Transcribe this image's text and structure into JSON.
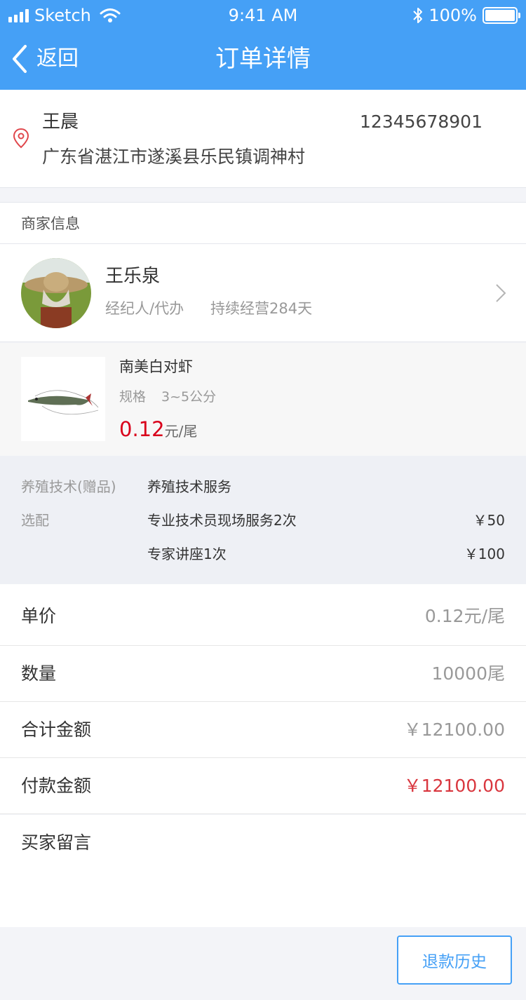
{
  "status_bar": {
    "carrier": "Sketch",
    "time": "9:41 AM",
    "battery": "100%",
    "icons": [
      "signal-icon",
      "wifi-icon",
      "bluetooth-icon",
      "battery-icon"
    ]
  },
  "nav": {
    "back_label": "返回",
    "title": "订单详情"
  },
  "address": {
    "name": "王晨",
    "phone": "12345678901",
    "address": "广东省湛江市遂溪县乐民镇调神村",
    "icon": "location-pin-icon"
  },
  "merchant": {
    "section_title": "商家信息",
    "name": "王乐泉",
    "role": "经纪人/代办",
    "days": "持续经营284天"
  },
  "product": {
    "name": "南美白对虾",
    "spec_label": "规格",
    "spec_value": "3~5公分",
    "price": "0.12",
    "price_unit": "元/尾"
  },
  "extras": {
    "gift_label": "养殖技术(赠品)",
    "gift_item": "养殖技术服务",
    "option_label": "选配",
    "options": [
      {
        "name": "专业技术员现场服务2次",
        "price": "￥50"
      },
      {
        "name": "专家讲座1次",
        "price": "￥100"
      }
    ]
  },
  "summary": {
    "unit_price_label": "单价",
    "unit_price": "0.12元/尾",
    "quantity_label": "数量",
    "quantity": "10000尾",
    "total_label": "合计金额",
    "total": "￥12100.00",
    "paid_label": "付款金额",
    "paid": "￥12100.00",
    "message_label": "买家留言"
  },
  "footer": {
    "refund_button": "退款历史"
  },
  "colors": {
    "brand_blue": "#45a0f6",
    "price_red": "#d9001b",
    "paid_red": "#d9363e"
  }
}
